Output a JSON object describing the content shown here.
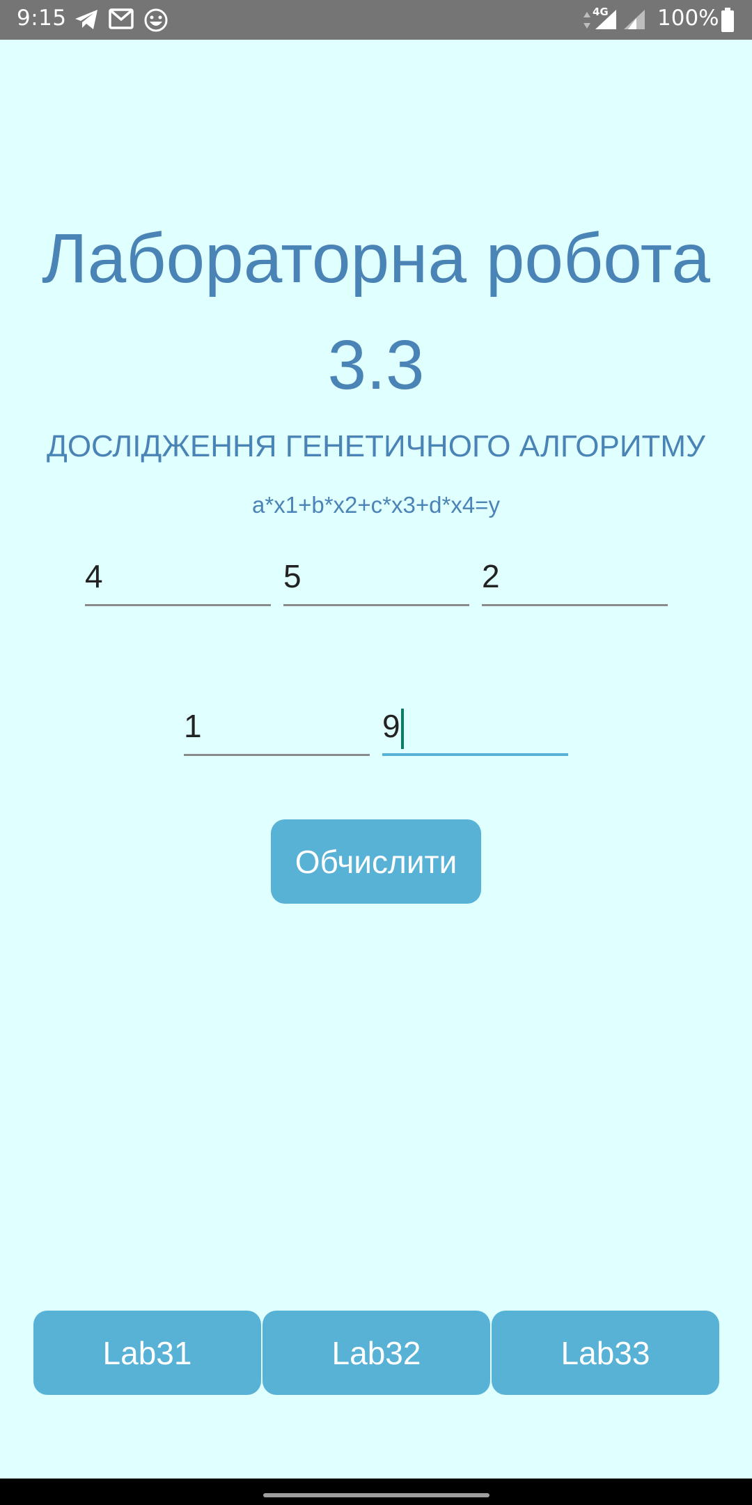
{
  "status_bar": {
    "time": "9:15",
    "network": "4G",
    "battery_percent": "100%",
    "icons": [
      "telegram-icon",
      "gmail-icon",
      "emoji-icon",
      "data-arrows-icon",
      "signal-icon",
      "signal-icon",
      "battery-icon"
    ]
  },
  "header": {
    "title_line1": "Лабораторна робота",
    "title_line2": "3.3",
    "subtitle": "ДОСЛІДЖЕННЯ ГЕНЕТИЧНОГО АЛГОРИТМУ",
    "formula": "a*x1+b*x2+c*x3+d*x4=y"
  },
  "inputs": {
    "a": "4",
    "b": "5",
    "c": "2",
    "d": "1",
    "y": "9"
  },
  "actions": {
    "calculate_label": "Обчислити"
  },
  "bottom_nav": {
    "lab31": "Lab31",
    "lab32": "Lab32",
    "lab33": "Lab33"
  },
  "colors": {
    "background": "#e0ffff",
    "accent": "#58b2d6",
    "title_text": "#4a83b5",
    "status_bar": "#757575"
  }
}
